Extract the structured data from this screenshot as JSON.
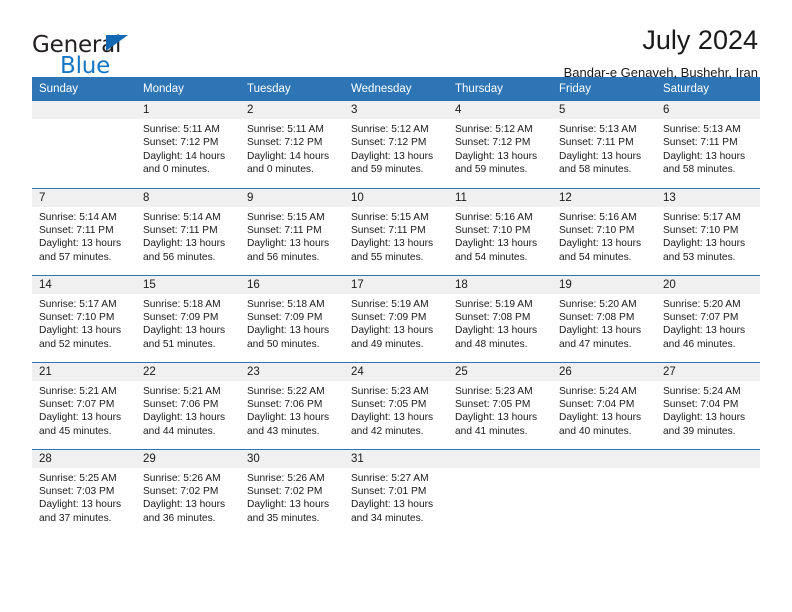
{
  "brand": {
    "name_top": "General",
    "name_bottom": "Blue",
    "triangle_icon": "triangle-icon"
  },
  "header": {
    "title": "July 2024",
    "location": "Bandar-e Genaveh, Bushehr, Iran"
  },
  "colors": {
    "header_blue": "#2e75b6",
    "daynum_gray": "#f0f0f0",
    "brand_blue": "#1577c4",
    "text": "#1a1a1a"
  },
  "weekdays": [
    "Sunday",
    "Monday",
    "Tuesday",
    "Wednesday",
    "Thursday",
    "Friday",
    "Saturday"
  ],
  "labels": {
    "sunrise_prefix": "Sunrise:",
    "sunset_prefix": "Sunset:",
    "daylight_prefix": "Daylight:"
  },
  "weeks": [
    [
      {
        "day": "",
        "empty": true
      },
      {
        "day": "1",
        "line1": "Sunrise: 5:11 AM",
        "line2": "Sunset: 7:12 PM",
        "line3": "Daylight: 14 hours and 0 minutes."
      },
      {
        "day": "2",
        "line1": "Sunrise: 5:11 AM",
        "line2": "Sunset: 7:12 PM",
        "line3": "Daylight: 14 hours and 0 minutes."
      },
      {
        "day": "3",
        "line1": "Sunrise: 5:12 AM",
        "line2": "Sunset: 7:12 PM",
        "line3": "Daylight: 13 hours and 59 minutes."
      },
      {
        "day": "4",
        "line1": "Sunrise: 5:12 AM",
        "line2": "Sunset: 7:12 PM",
        "line3": "Daylight: 13 hours and 59 minutes."
      },
      {
        "day": "5",
        "line1": "Sunrise: 5:13 AM",
        "line2": "Sunset: 7:11 PM",
        "line3": "Daylight: 13 hours and 58 minutes."
      },
      {
        "day": "6",
        "line1": "Sunrise: 5:13 AM",
        "line2": "Sunset: 7:11 PM",
        "line3": "Daylight: 13 hours and 58 minutes."
      }
    ],
    [
      {
        "day": "7",
        "line1": "Sunrise: 5:14 AM",
        "line2": "Sunset: 7:11 PM",
        "line3": "Daylight: 13 hours and 57 minutes."
      },
      {
        "day": "8",
        "line1": "Sunrise: 5:14 AM",
        "line2": "Sunset: 7:11 PM",
        "line3": "Daylight: 13 hours and 56 minutes."
      },
      {
        "day": "9",
        "line1": "Sunrise: 5:15 AM",
        "line2": "Sunset: 7:11 PM",
        "line3": "Daylight: 13 hours and 56 minutes."
      },
      {
        "day": "10",
        "line1": "Sunrise: 5:15 AM",
        "line2": "Sunset: 7:11 PM",
        "line3": "Daylight: 13 hours and 55 minutes."
      },
      {
        "day": "11",
        "line1": "Sunrise: 5:16 AM",
        "line2": "Sunset: 7:10 PM",
        "line3": "Daylight: 13 hours and 54 minutes."
      },
      {
        "day": "12",
        "line1": "Sunrise: 5:16 AM",
        "line2": "Sunset: 7:10 PM",
        "line3": "Daylight: 13 hours and 54 minutes."
      },
      {
        "day": "13",
        "line1": "Sunrise: 5:17 AM",
        "line2": "Sunset: 7:10 PM",
        "line3": "Daylight: 13 hours and 53 minutes."
      }
    ],
    [
      {
        "day": "14",
        "line1": "Sunrise: 5:17 AM",
        "line2": "Sunset: 7:10 PM",
        "line3": "Daylight: 13 hours and 52 minutes."
      },
      {
        "day": "15",
        "line1": "Sunrise: 5:18 AM",
        "line2": "Sunset: 7:09 PM",
        "line3": "Daylight: 13 hours and 51 minutes."
      },
      {
        "day": "16",
        "line1": "Sunrise: 5:18 AM",
        "line2": "Sunset: 7:09 PM",
        "line3": "Daylight: 13 hours and 50 minutes."
      },
      {
        "day": "17",
        "line1": "Sunrise: 5:19 AM",
        "line2": "Sunset: 7:09 PM",
        "line3": "Daylight: 13 hours and 49 minutes."
      },
      {
        "day": "18",
        "line1": "Sunrise: 5:19 AM",
        "line2": "Sunset: 7:08 PM",
        "line3": "Daylight: 13 hours and 48 minutes."
      },
      {
        "day": "19",
        "line1": "Sunrise: 5:20 AM",
        "line2": "Sunset: 7:08 PM",
        "line3": "Daylight: 13 hours and 47 minutes."
      },
      {
        "day": "20",
        "line1": "Sunrise: 5:20 AM",
        "line2": "Sunset: 7:07 PM",
        "line3": "Daylight: 13 hours and 46 minutes."
      }
    ],
    [
      {
        "day": "21",
        "line1": "Sunrise: 5:21 AM",
        "line2": "Sunset: 7:07 PM",
        "line3": "Daylight: 13 hours and 45 minutes."
      },
      {
        "day": "22",
        "line1": "Sunrise: 5:21 AM",
        "line2": "Sunset: 7:06 PM",
        "line3": "Daylight: 13 hours and 44 minutes."
      },
      {
        "day": "23",
        "line1": "Sunrise: 5:22 AM",
        "line2": "Sunset: 7:06 PM",
        "line3": "Daylight: 13 hours and 43 minutes."
      },
      {
        "day": "24",
        "line1": "Sunrise: 5:23 AM",
        "line2": "Sunset: 7:05 PM",
        "line3": "Daylight: 13 hours and 42 minutes."
      },
      {
        "day": "25",
        "line1": "Sunrise: 5:23 AM",
        "line2": "Sunset: 7:05 PM",
        "line3": "Daylight: 13 hours and 41 minutes."
      },
      {
        "day": "26",
        "line1": "Sunrise: 5:24 AM",
        "line2": "Sunset: 7:04 PM",
        "line3": "Daylight: 13 hours and 40 minutes."
      },
      {
        "day": "27",
        "line1": "Sunrise: 5:24 AM",
        "line2": "Sunset: 7:04 PM",
        "line3": "Daylight: 13 hours and 39 minutes."
      }
    ],
    [
      {
        "day": "28",
        "line1": "Sunrise: 5:25 AM",
        "line2": "Sunset: 7:03 PM",
        "line3": "Daylight: 13 hours and 37 minutes."
      },
      {
        "day": "29",
        "line1": "Sunrise: 5:26 AM",
        "line2": "Sunset: 7:02 PM",
        "line3": "Daylight: 13 hours and 36 minutes."
      },
      {
        "day": "30",
        "line1": "Sunrise: 5:26 AM",
        "line2": "Sunset: 7:02 PM",
        "line3": "Daylight: 13 hours and 35 minutes."
      },
      {
        "day": "31",
        "line1": "Sunrise: 5:27 AM",
        "line2": "Sunset: 7:01 PM",
        "line3": "Daylight: 13 hours and 34 minutes."
      },
      {
        "day": "",
        "empty": true
      },
      {
        "day": "",
        "empty": true
      },
      {
        "day": "",
        "empty": true
      }
    ]
  ]
}
